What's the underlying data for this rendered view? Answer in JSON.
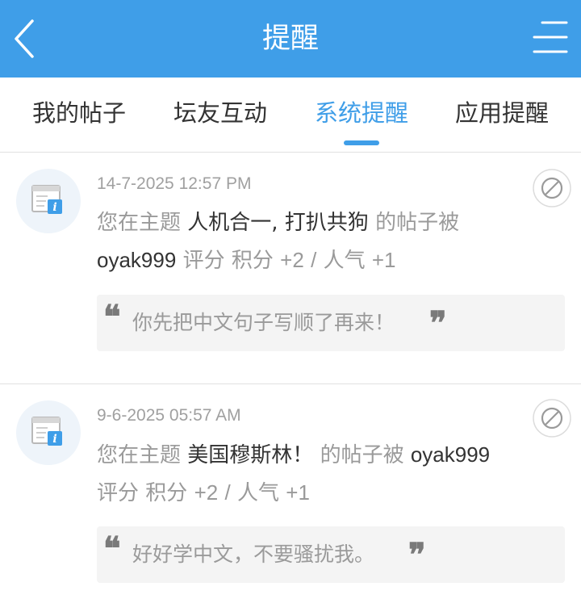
{
  "header": {
    "title": "提醒",
    "back_icon": "back-chevron-icon",
    "menu_icon": "menu-icon",
    "background_color": "#3f9ee8"
  },
  "tabs": [
    {
      "label": "我的帖子",
      "active": false
    },
    {
      "label": "坛友互动",
      "active": false
    },
    {
      "label": "系统提醒",
      "active": true
    },
    {
      "label": "应用提醒",
      "active": false
    }
  ],
  "accent_color": "#3f9ee8",
  "notices": [
    {
      "time": "14-7-2025 12:57 PM",
      "icon": "info-window-icon",
      "prefix": "您在主题",
      "topic": "人机合一, 打扒共狗",
      "middle": "的帖子被",
      "user": "oyak999",
      "action": "评分",
      "score_label": "积分",
      "score_value": "+2",
      "separator": "/",
      "pop_label": "人气",
      "pop_value": "+1",
      "quote": "你先把中文句子写顺了再来！"
    },
    {
      "time": "9-6-2025 05:57 AM",
      "icon": "info-window-icon",
      "prefix": "您在主题",
      "topic": "美国穆斯林！",
      "middle": "的帖子被",
      "user": "oyak999",
      "action": "评分",
      "score_label": "积分",
      "score_value": "+2",
      "separator": "/",
      "pop_label": "人气",
      "pop_value": "+1",
      "quote": "好好学中文，不要骚扰我。"
    }
  ]
}
